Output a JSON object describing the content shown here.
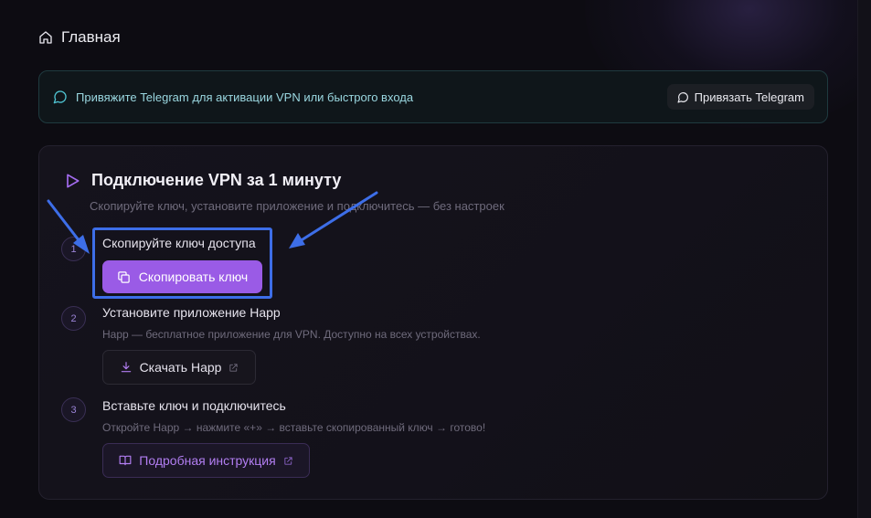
{
  "header": {
    "title": "Главная",
    "icon": "home-icon"
  },
  "telegram_banner": {
    "icon": "chat-bubble-icon",
    "text": "Привяжите Telegram для активации VPN или быстрого входа",
    "button_label": "Привязать Telegram",
    "button_icon": "chat-bubble-icon"
  },
  "vpn_card": {
    "icon": "play-icon",
    "title": "Подключение VPN за 1 минуту",
    "subtitle": "Скопируйте ключ, установите приложение и подключитесь — без настроек",
    "steps": [
      {
        "number": "1",
        "title": "Скопируйте ключ доступа",
        "button_label": "Скопировать ключ",
        "button_icon": "copy-icon"
      },
      {
        "number": "2",
        "title": "Установите приложение Happ",
        "description": "Happ — бесплатное приложение для VPN. Доступно на всех устройствах.",
        "button_label": "Скачать Happ",
        "button_icon": "download-icon",
        "button_trailing_icon": "external-link-icon"
      },
      {
        "number": "3",
        "title": "Вставьте ключ и подключитесь",
        "description": "Откройте Happ → нажмите «+» → вставьте скопированный ключ → готово!",
        "button_label": "Подробная инструкция",
        "button_icon": "book-icon",
        "button_trailing_icon": "external-link-icon"
      }
    ]
  },
  "colors": {
    "background": "#0d0c12",
    "accent": "#9a5be6",
    "telegram_accent": "#4fc3d1",
    "annotation": "#3d6ee8"
  }
}
